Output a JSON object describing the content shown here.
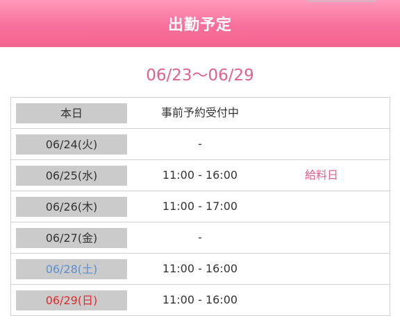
{
  "header": {
    "title": "出勤予定"
  },
  "week": {
    "range": "06/23〜06/29"
  },
  "schedule": {
    "rows": [
      {
        "day": "本日",
        "time": "事前予約受付中",
        "note": "",
        "day_type": "normal"
      },
      {
        "day": "06/24(火)",
        "time": "-",
        "note": "",
        "day_type": "normal"
      },
      {
        "day": "06/25(水)",
        "time": "11:00 - 16:00",
        "note": "給料日",
        "day_type": "normal"
      },
      {
        "day": "06/26(木)",
        "time": "11:00 - 17:00",
        "note": "",
        "day_type": "normal"
      },
      {
        "day": "06/27(金)",
        "time": "-",
        "note": "",
        "day_type": "normal"
      },
      {
        "day": "06/28(土)",
        "time": "11:00 - 16:00",
        "note": "",
        "day_type": "saturday"
      },
      {
        "day": "06/29(日)",
        "time": "11:00 - 16:00",
        "note": "",
        "day_type": "sunday"
      }
    ]
  },
  "colors": {
    "header_pink": "#f7719c",
    "accent_pink": "#e0608c",
    "saturday_blue": "#5b8fd0",
    "sunday_red": "#e02a2a",
    "day_cell_gray": "#cbcbcb"
  }
}
